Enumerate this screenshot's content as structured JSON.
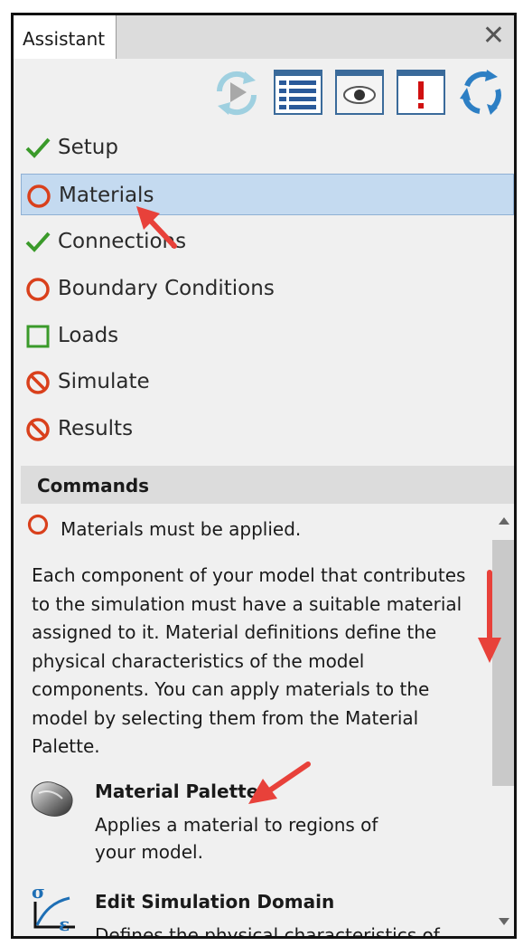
{
  "panel": {
    "title": "Assistant",
    "close_glyph": "✕"
  },
  "toolbar": {
    "buttons": [
      {
        "icon": "refresh-play-icon"
      },
      {
        "icon": "list-view-icon"
      },
      {
        "icon": "eye-icon"
      },
      {
        "icon": "warning-icon"
      },
      {
        "icon": "sync-icon"
      }
    ]
  },
  "workflow": {
    "items": [
      {
        "label": "Setup",
        "status": "complete"
      },
      {
        "label": "Materials",
        "status": "required",
        "selected": true
      },
      {
        "label": "Connections",
        "status": "complete"
      },
      {
        "label": "Boundary Conditions",
        "status": "required"
      },
      {
        "label": "Loads",
        "status": "optional"
      },
      {
        "label": "Simulate",
        "status": "blocked"
      },
      {
        "label": "Results",
        "status": "blocked"
      }
    ]
  },
  "commands": {
    "header": "Commands",
    "status_message": "Materials must be applied.",
    "description": "Each component of your model that contributes to the simulation must have a suitable material assigned to it. Material definitions define the physical characteristics of the model components. You can apply materials to the model by selecting them from the Material Palette.",
    "items": [
      {
        "title": "Material Palette",
        "description": "Applies a material to regions of your model."
      },
      {
        "title": "Edit Simulation Domain",
        "description": "Defines the physical characteristics of"
      }
    ]
  },
  "colors": {
    "complete": "#3a9a2a",
    "required": "#d9401c",
    "optional": "#3a9a2a",
    "blocked": "#d9401c",
    "selection": "#c4daf0",
    "annotation_arrow": "#e8413a"
  }
}
